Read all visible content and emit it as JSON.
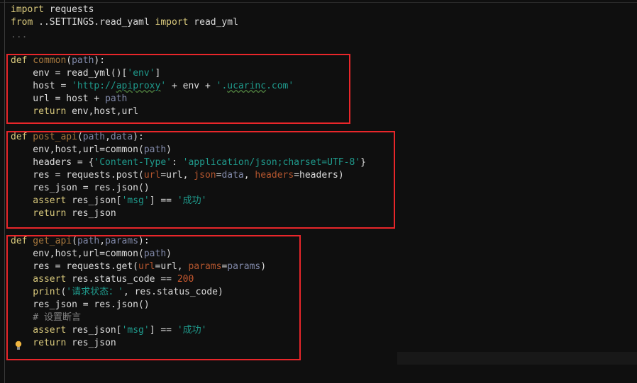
{
  "editor": {
    "language": "python",
    "colors": {
      "background": "#0f0f0f",
      "keyword": "#d9c97c",
      "function": "#a8783e",
      "parameter": "#8088a8",
      "string": "#1f9a8c",
      "kwarg": "#b5562e",
      "number": "#c7582f",
      "comment": "#808080",
      "highlight_box": "#e8262a"
    },
    "lines": [
      [
        {
          "t": "import",
          "c": "kw"
        },
        {
          "t": " requests",
          "c": "id"
        }
      ],
      [
        {
          "t": "from",
          "c": "kw"
        },
        {
          "t": " ..SETTINGS.read_yaml ",
          "c": "id"
        },
        {
          "t": "import",
          "c": "kw"
        },
        {
          "t": " read_yml",
          "c": "id"
        }
      ],
      [
        {
          "t": "...",
          "c": "fold"
        }
      ],
      [],
      [
        {
          "t": "def",
          "c": "kw"
        },
        {
          "t": " common",
          "c": "fn"
        },
        {
          "t": "(",
          "c": "id"
        },
        {
          "t": "path",
          "c": "pa"
        },
        {
          "t": "):",
          "c": "id"
        }
      ],
      [
        {
          "t": "    env = read_yml()[",
          "c": "id"
        },
        {
          "t": "'env'",
          "c": "st"
        },
        {
          "t": "]",
          "c": "id"
        }
      ],
      [
        {
          "t": "    host = ",
          "c": "id"
        },
        {
          "t": "'http://",
          "c": "st"
        },
        {
          "t": "apiproxy",
          "c": "st sq"
        },
        {
          "t": "'",
          "c": "st"
        },
        {
          "t": " + env + ",
          "c": "id"
        },
        {
          "t": "'.",
          "c": "st"
        },
        {
          "t": "ucarinc",
          "c": "st sq"
        },
        {
          "t": ".com'",
          "c": "st"
        }
      ],
      [
        {
          "t": "    url = host + ",
          "c": "id"
        },
        {
          "t": "path",
          "c": "pa"
        }
      ],
      [
        {
          "t": "    return",
          "c": "kw"
        },
        {
          "t": " env,host,url",
          "c": "id"
        }
      ],
      [],
      [
        {
          "t": "def",
          "c": "kw"
        },
        {
          "t": " post_api",
          "c": "fn"
        },
        {
          "t": "(",
          "c": "id"
        },
        {
          "t": "path",
          "c": "pa"
        },
        {
          "t": ",",
          "c": "id"
        },
        {
          "t": "data",
          "c": "pa"
        },
        {
          "t": "):",
          "c": "id"
        }
      ],
      [
        {
          "t": "    env,host,url=common(",
          "c": "id"
        },
        {
          "t": "path",
          "c": "pa"
        },
        {
          "t": ")",
          "c": "id"
        }
      ],
      [
        {
          "t": "    headers = {",
          "c": "id"
        },
        {
          "t": "'Content-Type'",
          "c": "st"
        },
        {
          "t": ": ",
          "c": "id"
        },
        {
          "t": "'application/json;charset=UTF-8'",
          "c": "st"
        },
        {
          "t": "}",
          "c": "id"
        }
      ],
      [
        {
          "t": "    res = requests.post(",
          "c": "id"
        },
        {
          "t": "url",
          "c": "kv"
        },
        {
          "t": "=url, ",
          "c": "id"
        },
        {
          "t": "json",
          "c": "kv"
        },
        {
          "t": "=",
          "c": "id"
        },
        {
          "t": "data",
          "c": "pa"
        },
        {
          "t": ", ",
          "c": "id"
        },
        {
          "t": "headers",
          "c": "kv"
        },
        {
          "t": "=headers)",
          "c": "id"
        }
      ],
      [
        {
          "t": "    res_json = res.json()",
          "c": "id"
        }
      ],
      [
        {
          "t": "    assert",
          "c": "kw"
        },
        {
          "t": " res_json[",
          "c": "id"
        },
        {
          "t": "'msg'",
          "c": "st"
        },
        {
          "t": "] == ",
          "c": "id"
        },
        {
          "t": "'成功'",
          "c": "st"
        }
      ],
      [
        {
          "t": "    return",
          "c": "kw"
        },
        {
          "t": " res_json",
          "c": "id"
        }
      ],
      [],
      [
        {
          "t": "def",
          "c": "kw"
        },
        {
          "t": " get_api",
          "c": "fn"
        },
        {
          "t": "(",
          "c": "id"
        },
        {
          "t": "path",
          "c": "pa"
        },
        {
          "t": ",",
          "c": "id"
        },
        {
          "t": "params",
          "c": "pa"
        },
        {
          "t": "):",
          "c": "id"
        }
      ],
      [
        {
          "t": "    env,host,url=common(",
          "c": "id"
        },
        {
          "t": "path",
          "c": "pa"
        },
        {
          "t": ")",
          "c": "id"
        }
      ],
      [
        {
          "t": "    res = requests.get(",
          "c": "id"
        },
        {
          "t": "url",
          "c": "kv"
        },
        {
          "t": "=url, ",
          "c": "id"
        },
        {
          "t": "params",
          "c": "kv"
        },
        {
          "t": "=",
          "c": "id"
        },
        {
          "t": "params",
          "c": "pa"
        },
        {
          "t": ")",
          "c": "id"
        }
      ],
      [
        {
          "t": "    assert",
          "c": "kw"
        },
        {
          "t": " res.status_code == ",
          "c": "id"
        },
        {
          "t": "200",
          "c": "nu"
        }
      ],
      [
        {
          "t": "    print",
          "c": "kw"
        },
        {
          "t": "(",
          "c": "id"
        },
        {
          "t": "'请求状态：'",
          "c": "st"
        },
        {
          "t": ", res.status_code)",
          "c": "id"
        }
      ],
      [
        {
          "t": "    res_json = res.json()",
          "c": "id"
        }
      ],
      [
        {
          "t": "    # 设置断言",
          "c": "cm"
        }
      ],
      [
        {
          "t": "    assert",
          "c": "kw"
        },
        {
          "t": " res_json[",
          "c": "id"
        },
        {
          "t": "'msg'",
          "c": "st"
        },
        {
          "t": "] == ",
          "c": "id"
        },
        {
          "t": "'成功'",
          "c": "st"
        }
      ],
      [
        {
          "t": "    return",
          "c": "kw"
        },
        {
          "t": " res_json",
          "c": "id"
        }
      ]
    ]
  }
}
